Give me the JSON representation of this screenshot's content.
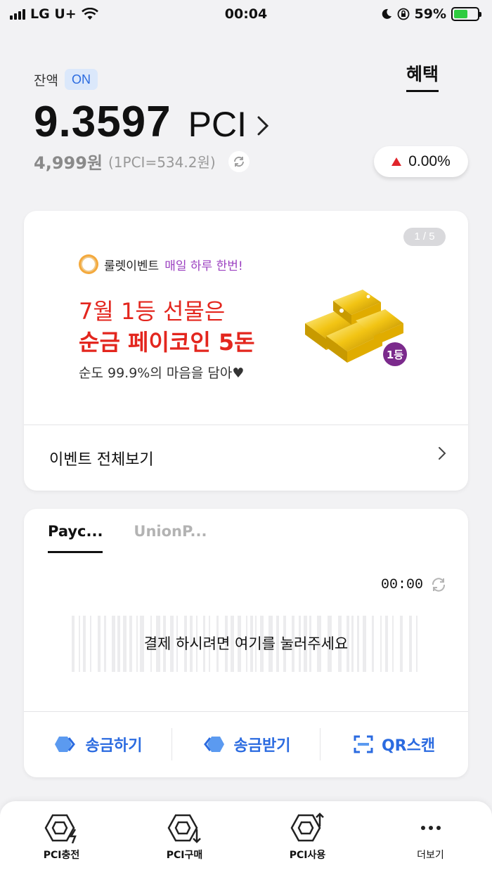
{
  "status_bar": {
    "carrier": "LG U+",
    "time": "00:04",
    "battery_pct": "59%",
    "battery_level": 0.59
  },
  "header": {
    "balance_label": "잔액",
    "balance_badge": "ON",
    "benefit_tab": "혜택",
    "pci_amount": "9.3597",
    "pci_unit": "PCI",
    "won_amount": "4,999원",
    "rate": "(1PCI=534.2원)",
    "change_pct": "0.00%"
  },
  "event_card": {
    "page_indicator": "1 / 5",
    "event_name": "룰렛이벤트",
    "event_frequency": "매일 하루 한번!",
    "title_line_1": "7월 1등 선물은",
    "title_line_2": "순금 페이코인 5돈",
    "description": "순도 99.9%의 마음을 담아♥",
    "prize_badge": "1등",
    "view_all": "이벤트 전체보기"
  },
  "pay_card": {
    "tabs": [
      {
        "label": "Payc..."
      },
      {
        "label": "UnionP..."
      }
    ],
    "timer": "00:00",
    "barcode_prompt": "결제 하시려면 여기를 눌러주세요",
    "actions": [
      {
        "label": "송금하기",
        "icon": "send-icon"
      },
      {
        "label": "송금받기",
        "icon": "receive-icon"
      },
      {
        "label": "QR스캔",
        "icon": "qr-scan-icon"
      }
    ]
  },
  "bottom_nav": {
    "items": [
      {
        "label": "PCI충전",
        "icon": "pci-charge-icon"
      },
      {
        "label": "PCI구매",
        "icon": "pci-buy-icon"
      },
      {
        "label": "PCI사용",
        "icon": "pci-use-icon"
      },
      {
        "label": "더보기",
        "icon": "more-icon"
      }
    ]
  },
  "colors": {
    "accent_blue": "#2b6be0",
    "event_red": "#e3261e",
    "event_purple": "#9b3fc0",
    "up_red": "#e0242b",
    "background": "#f2f2f4"
  }
}
